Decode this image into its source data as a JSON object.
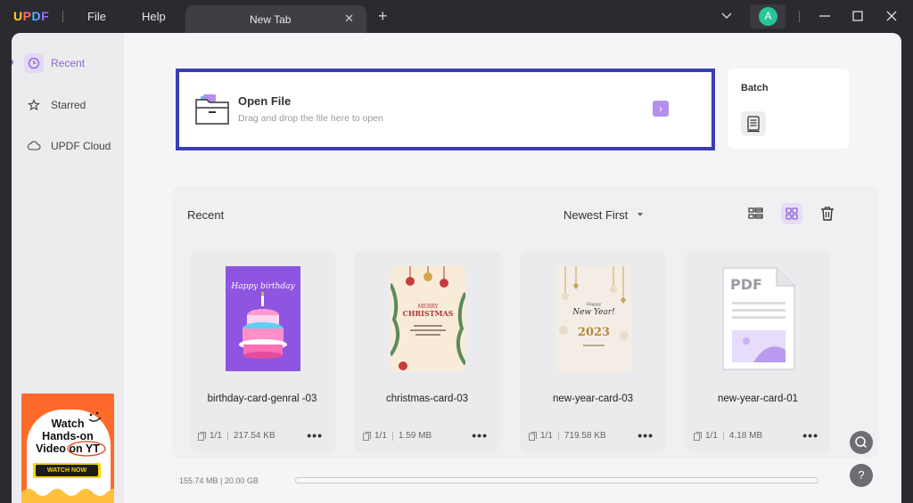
{
  "app": {
    "logo": "UPDF",
    "menu_file": "File",
    "menu_help": "Help"
  },
  "tab": {
    "title": "New Tab",
    "close": "✕",
    "new": "+"
  },
  "account": {
    "initial": "A"
  },
  "sidebar": {
    "items": [
      {
        "label": "Recent",
        "icon": "clock-icon",
        "active": true
      },
      {
        "label": "Starred",
        "icon": "star-icon"
      },
      {
        "label": "UPDF Cloud",
        "icon": "cloud-icon"
      }
    ]
  },
  "ad": {
    "line1": "Watch",
    "line2": "Hands-on",
    "line3": "Video on YT",
    "button": "WATCH NOW"
  },
  "open_file": {
    "title": "Open File",
    "subtitle": "Drag and drop the file here to open",
    "arrow": "›"
  },
  "batch": {
    "label": "Batch"
  },
  "recent": {
    "title": "Recent",
    "sort": "Newest First",
    "files": [
      {
        "name": "birthday-card-genral -03",
        "pages": "1/1",
        "size": "217.54 KB",
        "more": "•••"
      },
      {
        "name": "christmas-card-03",
        "pages": "1/1",
        "size": "1.59 MB",
        "more": "•••"
      },
      {
        "name": "new-year-card-03",
        "pages": "1/1",
        "size": "719.58 KB",
        "more": "•••"
      },
      {
        "name": "new-year-card-01",
        "pages": "1/1",
        "size": "4.18 MB",
        "more": "•••"
      }
    ]
  },
  "thumbs": {
    "birthday": {
      "line1": "Happy birthday"
    },
    "christmas": {
      "line1": "MERRY",
      "line2": "CHRISTMAS"
    },
    "newyear": {
      "line1": "Happy",
      "line2": "New Year!",
      "year": "2023"
    },
    "pdf": {
      "label": "PDF"
    }
  },
  "storage": {
    "text": "155.74 MB | 20.00 GB"
  },
  "right_buttons": {
    "search": "⌕",
    "help": "?"
  },
  "colors": {
    "accent": "#8a63d2",
    "highlight_border": "#3a3db4",
    "titlebar": "#2b2b2f"
  }
}
